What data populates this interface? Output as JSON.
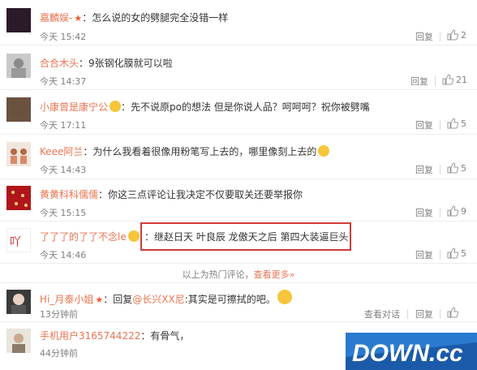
{
  "comments": [
    {
      "name": "嘉麟娱-",
      "text": "：怎么说的女的劈腿完全没错一样",
      "time": "今天 15:42",
      "reply": "回复",
      "likes": "2"
    },
    {
      "name": "合合木头",
      "text": "：9张钢化膜就可以啦",
      "time": "今天 14:37",
      "reply": "回复",
      "likes": "21"
    },
    {
      "name": "小康曾是康宁公",
      "text": "：先不说原po的想法 但是你说人品？呵呵呵？祝你被劈嘴",
      "time": "今天 17:11",
      "reply": "回复",
      "likes": "5"
    },
    {
      "name": "Keee阿兰",
      "text": "：为什么我看着很像用粉笔写上去的，哪里像刻上去的",
      "time": "今天 14:43",
      "reply": "回复",
      "likes": "5"
    },
    {
      "name": "黄黄科科儒儒",
      "text": "：你这三点评论让我决定不仅要取关还要举报你",
      "time": "今天 15:15",
      "reply": "回复",
      "likes": "9"
    },
    {
      "name": "了了了的了了不念le",
      "text": "：继赵日天 叶良辰 龙傲天之后 第四大装逼巨头",
      "time": "今天 14:46",
      "reply": "回复",
      "likes": "5"
    }
  ],
  "hot_bar": {
    "text": "以上为热门评论，",
    "more": "查看更多»"
  },
  "recent": [
    {
      "name": "Hi_月泰小姐",
      "reply_prefix": "：回复",
      "mention": "@长兴XX尼",
      "text": ":其实是可擦拭的吧。",
      "time": "13分钟前",
      "view_convo": "查看对话",
      "reply": "回复",
      "likes": ""
    },
    {
      "name": "手机用户3165744222",
      "text": "：有骨气，",
      "time": "44分钟前"
    }
  ],
  "watermark": {
    "text": "DOWN.cc"
  },
  "colors": {
    "name": "#eb7350",
    "highlight": "#d33a3a",
    "text": "#333333",
    "meta": "#808080"
  }
}
